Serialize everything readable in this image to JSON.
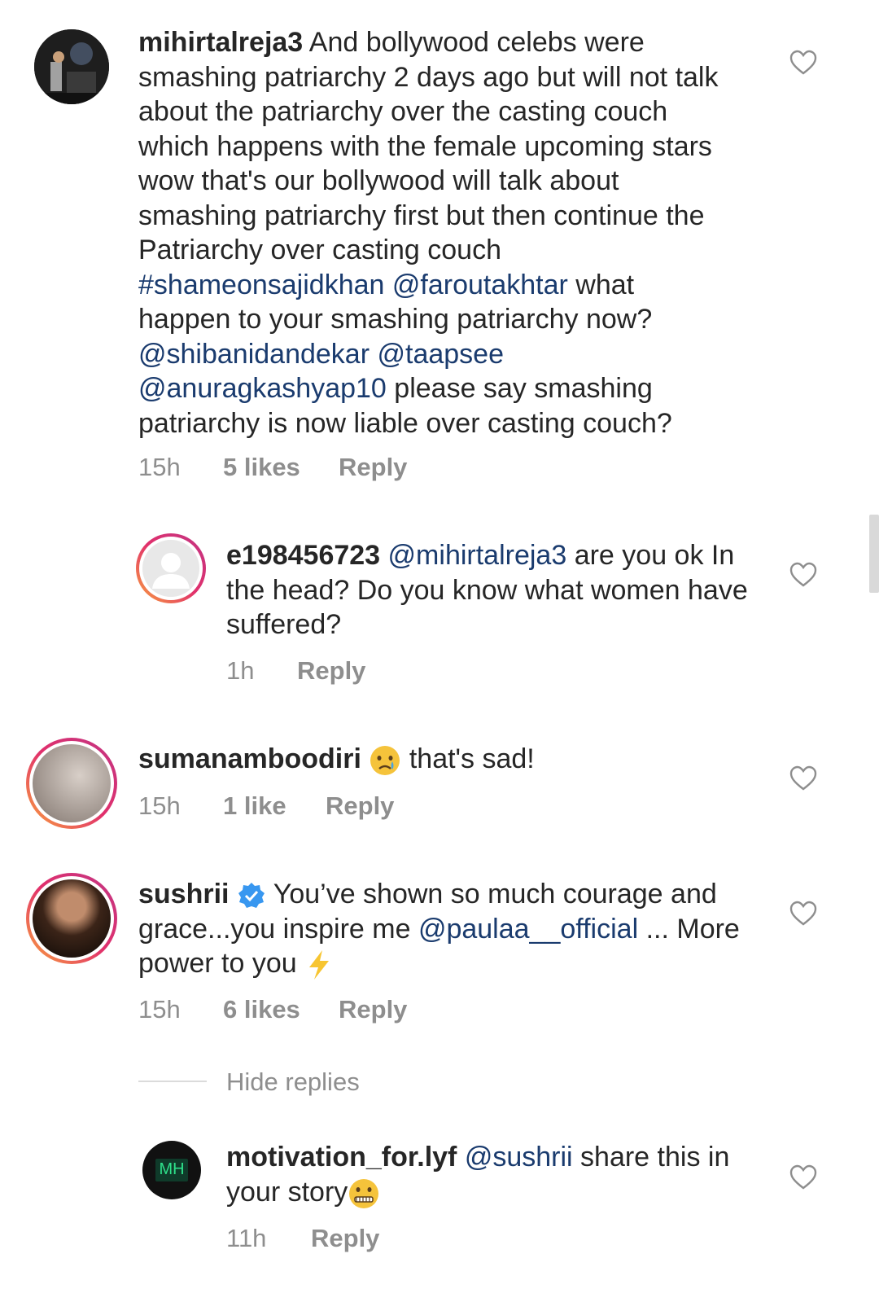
{
  "comments": [
    {
      "username": "mihirtalreja3",
      "segments": [
        " And bollywood celebs were smashing patriarchy 2 days ago but will not talk about the patriarchy over the casting couch which happens with the female upcoming stars wow that's our bollywood will talk about smashing patriarchy first but then continue the Patriarchy over casting couch ",
        "#shameonsajidkhan @faroutakhtar",
        " what happen to your smashing patriarchy now? ",
        "@shibanidandekar @taapsee @anuragkashyap10",
        " please say smashing patriarchy is now liable over casting couch?"
      ],
      "time": "15h",
      "likes": "5 likes",
      "reply": "Reply"
    },
    {
      "username": "e198456723",
      "mention": "@mihirtalreja3",
      "text": " are you ok In the head? Do you know what women have suffered?",
      "time": "1h",
      "reply": "Reply"
    },
    {
      "username": "sumanamboodiri",
      "text": " that's sad!",
      "emoji": "crying-face-emoji",
      "time": "15h",
      "likes": "1 like",
      "reply": "Reply"
    },
    {
      "username": "sushrii",
      "text_a": " You’ve shown so much courage and grace...you inspire me ",
      "mention": "@paulaa__official",
      "text_b": " ... More power to you ",
      "emoji": "lightning-emoji",
      "time": "15h",
      "likes": "6 likes",
      "reply": "Reply"
    },
    {
      "username": "motivation_for.lyf",
      "mention": "@sushrii",
      "text": " share this in your story",
      "emoji": "zipper-mouth-emoji",
      "avatar_text": "MH",
      "time": "11h",
      "reply": "Reply"
    }
  ],
  "hide_replies": "Hide replies",
  "colors": {
    "link": "#1a3b6e",
    "meta": "#8e8e8e",
    "text": "#262626",
    "verified": "#3897f0"
  }
}
